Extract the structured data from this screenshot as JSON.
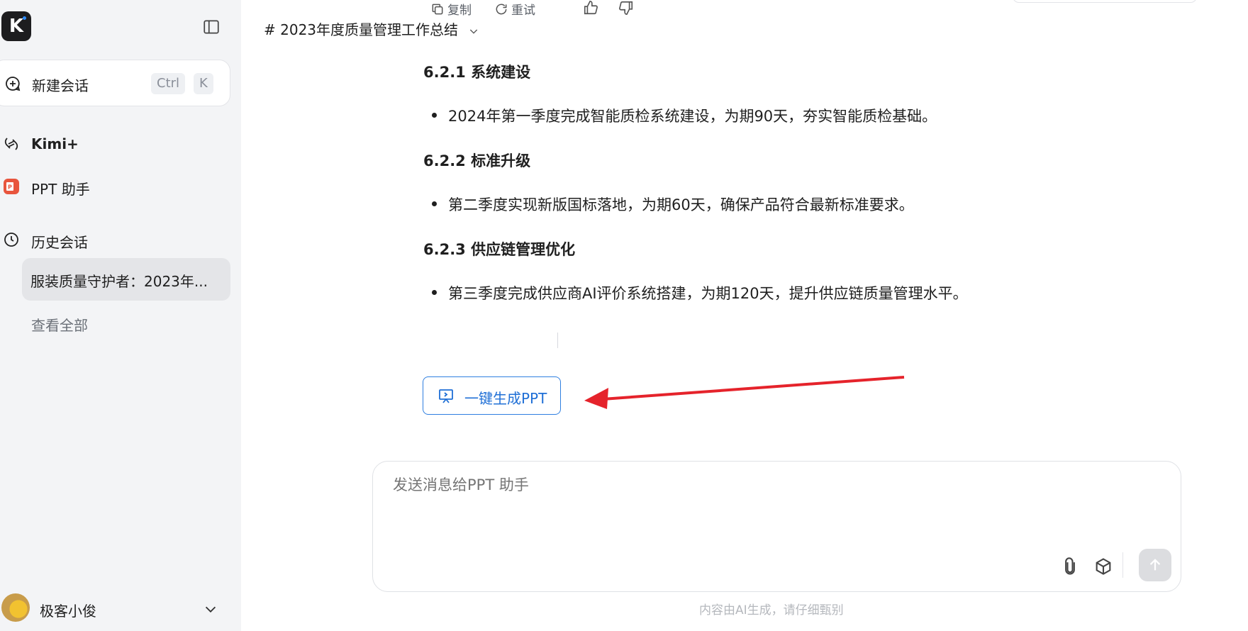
{
  "sidebar": {
    "logo_letter": "K",
    "new_chat": {
      "label": "新建会话",
      "shortcut_ctrl": "Ctrl",
      "shortcut_key": "K"
    },
    "items": [
      {
        "label": "Kimi+"
      },
      {
        "label": "PPT 助手"
      },
      {
        "label": "历史会话"
      }
    ],
    "history": [
      {
        "label": "服装质量守护者：2023年..."
      }
    ],
    "see_all": "查看全部",
    "user": {
      "name": "极客小俊"
    }
  },
  "conversation": {
    "title": "# 2023年度质量管理工作总结",
    "sections": [
      {
        "heading": "6.2.1 系统建设",
        "bullet": "2024年第一季度完成智能质检系统建设，为期90天，夯实智能质检基础。"
      },
      {
        "heading": "6.2.2 标准升级",
        "bullet": "第二季度实现新版国标落地，为期60天，确保产品符合最新标准要求。"
      },
      {
        "heading": "6.2.3 供应链管理优化",
        "bullet": "第三季度完成供应商AI评价系统搭建，为期120天，提升供应链质量管理水平。"
      }
    ],
    "actions": {
      "copy": "复制",
      "retry": "重试"
    },
    "generate_ppt": "一键生成PPT"
  },
  "input": {
    "placeholder": "发送消息给PPT 助手"
  },
  "footer_note": "内容由AI生成，请仔细甄别",
  "colors": {
    "accent": "#2f7fe0",
    "annotation_arrow": "#e5232b",
    "sidebar_bg": "#f3f4f6"
  }
}
